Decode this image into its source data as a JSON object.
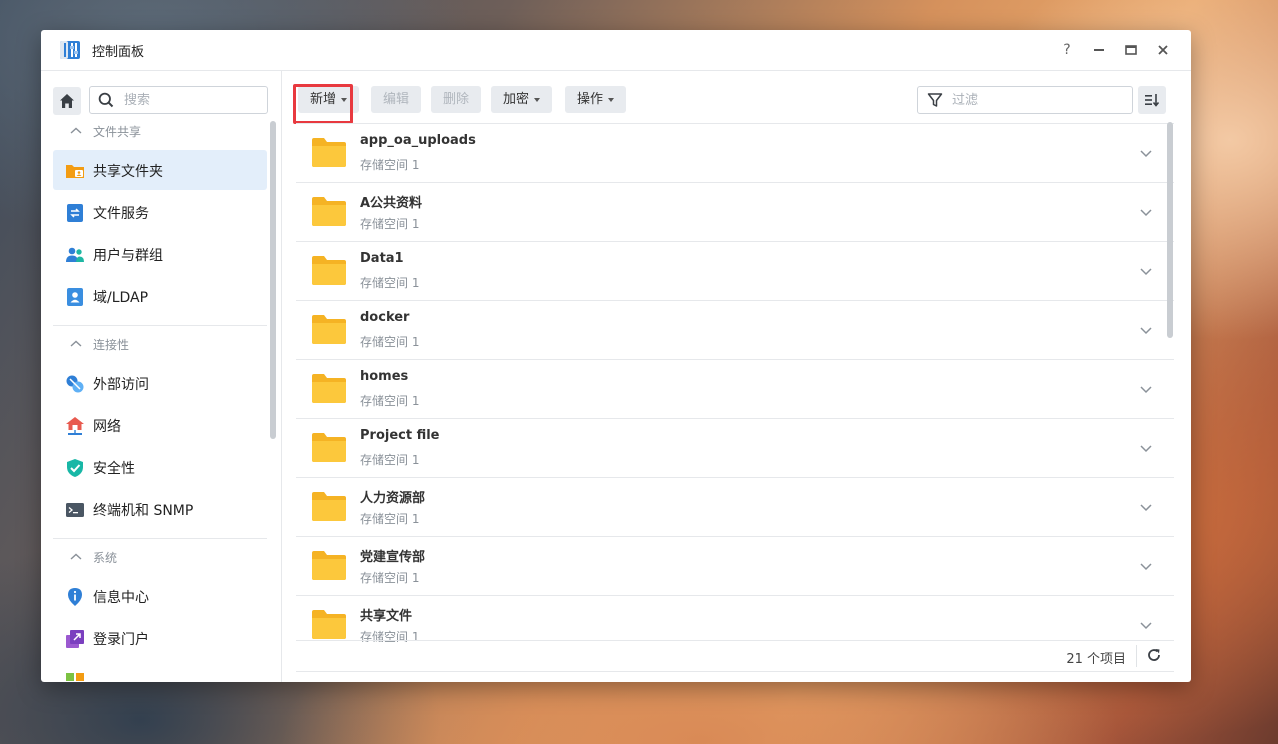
{
  "window": {
    "title": "控制面板"
  },
  "window_controls": {
    "help": "?"
  },
  "sidebar": {
    "search_placeholder": "搜索",
    "groups": [
      {
        "label": "文件共享",
        "items": [
          {
            "label": "共享文件夹",
            "icon": "shared-folder-icon",
            "active": true
          },
          {
            "label": "文件服务",
            "icon": "file-services-icon"
          },
          {
            "label": "用户与群组",
            "icon": "users-groups-icon"
          },
          {
            "label": "域/LDAP",
            "icon": "domain-ldap-icon"
          }
        ]
      },
      {
        "label": "连接性",
        "items": [
          {
            "label": "外部访问",
            "icon": "external-access-icon"
          },
          {
            "label": "网络",
            "icon": "network-icon"
          },
          {
            "label": "安全性",
            "icon": "security-icon"
          },
          {
            "label": "终端机和 SNMP",
            "icon": "terminal-icon"
          }
        ]
      },
      {
        "label": "系统",
        "items": [
          {
            "label": "信息中心",
            "icon": "info-center-icon"
          },
          {
            "label": "登录门户",
            "icon": "login-portal-icon"
          }
        ]
      }
    ]
  },
  "toolbar": {
    "create": "新增",
    "edit": "编辑",
    "delete": "删除",
    "encrypt": "加密",
    "action": "操作",
    "filter_placeholder": "过滤"
  },
  "folders": [
    {
      "name": "app_oa_uploads",
      "volume": "存储空间 1"
    },
    {
      "name": "A公共资料",
      "volume": "存储空间 1"
    },
    {
      "name": "Data1",
      "volume": "存储空间 1"
    },
    {
      "name": "docker",
      "volume": "存储空间 1"
    },
    {
      "name": "homes",
      "volume": "存储空间 1"
    },
    {
      "name": "Project file",
      "volume": "存储空间 1"
    },
    {
      "name": "人力资源部",
      "volume": "存储空间 1"
    },
    {
      "name": "党建宣传部",
      "volume": "存储空间 1"
    },
    {
      "name": "共享文件",
      "volume": "存储空间 1"
    }
  ],
  "footer": {
    "count": "21 个项目"
  },
  "colors": {
    "accent": "#1f6fd1",
    "folder": "#f8c02f",
    "highlight": "#e8393f",
    "active_bg": "#e3eefa"
  }
}
